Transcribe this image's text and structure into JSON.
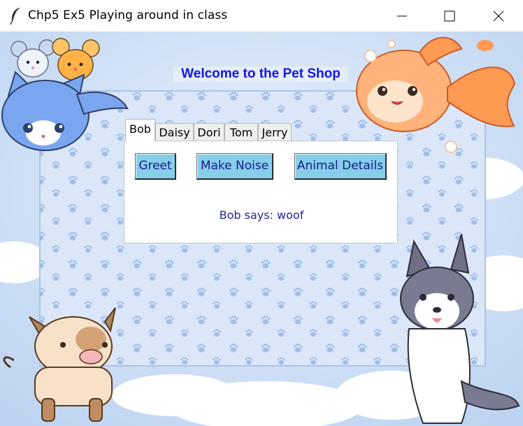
{
  "window": {
    "title": "Chp5 Ex5 Playing around in class",
    "icons": {
      "app": "feather-icon",
      "minimize": "minimize-icon",
      "maximize": "maximize-icon",
      "close": "close-icon"
    }
  },
  "header": {
    "text": "Welcome to the Pet Shop",
    "color": "#1515e6"
  },
  "notebook": {
    "tabs": [
      "Bob",
      "Daisy",
      "Dori",
      "Tom",
      "Jerry"
    ],
    "active_tab": "Bob"
  },
  "buttons": {
    "greet": "Greet",
    "make_noise": "Make Noise",
    "animal_details": "Animal Details",
    "color": "#87ceeb"
  },
  "status": {
    "text": "Bob says: woof"
  },
  "decorations": [
    "mice-illustration",
    "cat-illustration",
    "goldfish-illustration",
    "cow-illustration",
    "husky-illustration",
    "paw-print-pattern",
    "clouds"
  ]
}
